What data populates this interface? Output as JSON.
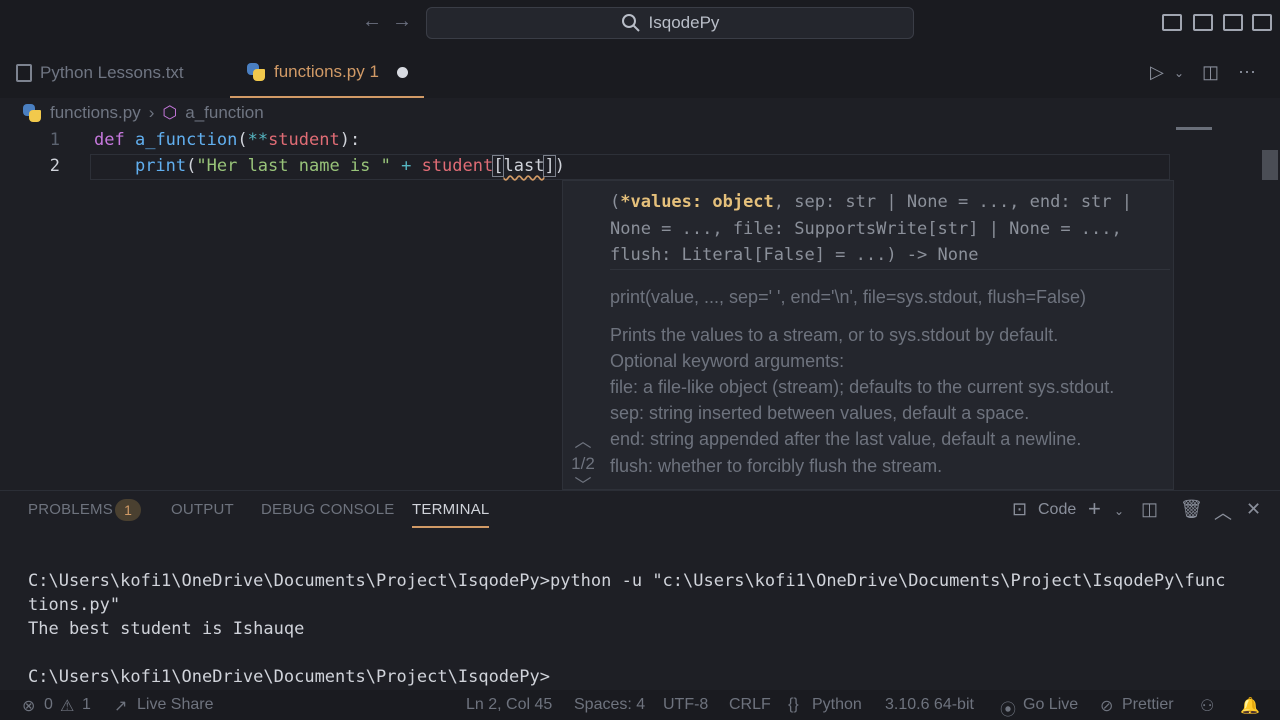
{
  "titlebar": {
    "search_text": "IsqodePy"
  },
  "tabs": [
    {
      "label": "Python Lessons.txt"
    },
    {
      "label": "functions.py 1"
    }
  ],
  "breadcrumb": {
    "file": "functions.py",
    "symbol": "a_function"
  },
  "editor": {
    "line_numbers": [
      "1",
      "2"
    ],
    "line1": {
      "kw": "def",
      "fn": "a_function",
      "p1": "(",
      "op": "**",
      "param": "student",
      "p2": "):"
    },
    "line2": {
      "indent": "    ",
      "fn": "print",
      "p1": "(",
      "str": "\"Her last name is \"",
      "op": " + ",
      "var": "student",
      "b1": "[",
      "arg": "last",
      "b2": "]",
      "p2": ")"
    }
  },
  "hover": {
    "sig_start": "(",
    "sig_bold": "*values: object",
    "sig_rest": ", sep: str | None = ..., end: str | None = ..., file: SupportsWrite[str] | None = ..., flush: Literal[False] = ...) -> None",
    "doc_lines": [
      "print(value, ..., sep=' ', end='\\n', file=sys.stdout, flush=False)",
      "Prints the values to a stream, or to sys.stdout by default.",
      "Optional keyword arguments:",
      "file: a file-like object (stream); defaults to the current sys.stdout.",
      "sep: string inserted between values, default a space.",
      "end: string appended after the last value, default a newline.",
      "flush: whether to forcibly flush the stream."
    ],
    "pager": "1/2"
  },
  "panel": {
    "tabs": [
      "PROBLEMS",
      "OUTPUT",
      "DEBUG CONSOLE",
      "TERMINAL"
    ],
    "problems_count": "1",
    "terminal_profile": "Code",
    "terminal_lines": [
      "C:\\Users\\kofi1\\OneDrive\\Documents\\Project\\IsqodePy>python -u \"c:\\Users\\kofi1\\OneDrive\\Documents\\Project\\IsqodePy\\func",
      "tions.py\"",
      "The best student is Ishauqe",
      "",
      "C:\\Users\\kofi1\\OneDrive\\Documents\\Project\\IsqodePy>"
    ]
  },
  "statusbar": {
    "errors": "0",
    "warnings": "1",
    "live_share": "Live Share",
    "position": "Ln 2, Col 45",
    "spaces": "Spaces: 4",
    "encoding": "UTF-8",
    "eol": "CRLF",
    "language": "Python",
    "interpreter": "3.10.6 64-bit",
    "go_live": "Go Live",
    "prettier": "Prettier"
  }
}
